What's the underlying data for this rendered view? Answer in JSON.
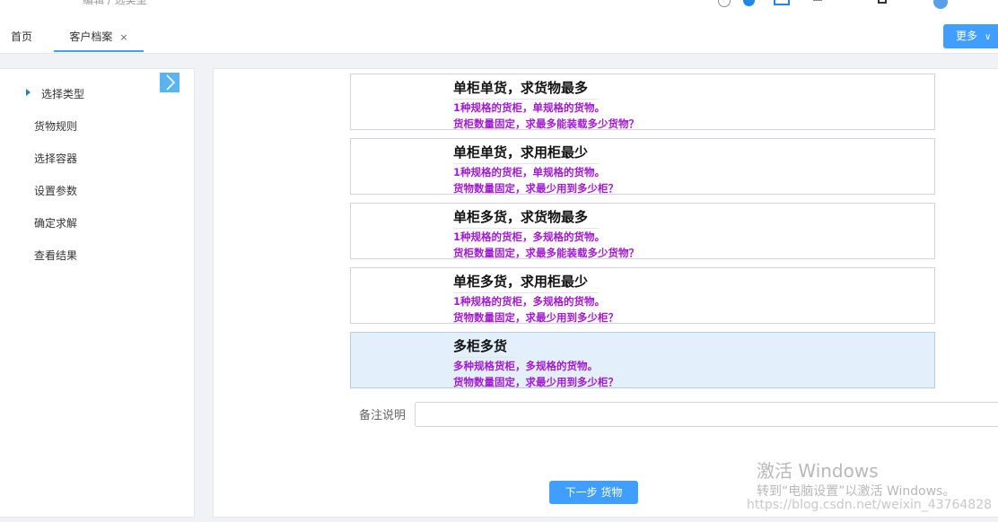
{
  "app": {
    "header_partial_title": "编辑 / 选类型"
  },
  "tabs": [
    {
      "label": "首页"
    },
    {
      "label": "客户档案",
      "close": "×"
    }
  ],
  "more_button": {
    "label": "更多",
    "caret": "∨"
  },
  "sidebar": {
    "collapse_icon": "›",
    "steps": [
      {
        "label": "选择类型",
        "active": true
      },
      {
        "label": "货物规则"
      },
      {
        "label": "选择容器"
      },
      {
        "label": "设置参数"
      },
      {
        "label": "确定求解"
      },
      {
        "label": "查看结果"
      }
    ]
  },
  "options": [
    {
      "title": "单柜单货，求货物最多",
      "line1": "1种规格的货柜，单规格的货物。",
      "line2": "货柜数量固定，求最多能装载多少货物？",
      "selected": false
    },
    {
      "title": "单柜单货，求用柜最少",
      "line1": "1种规格的货柜，单规格的货物。",
      "line2": "货物数量固定，求最少用到多少柜？",
      "selected": false
    },
    {
      "title": "单柜多货，求货物最多",
      "line1": "1种规格的货柜，多规格的货物。",
      "line2": "货柜数量固定，求最多能装载多少货物？",
      "selected": false
    },
    {
      "title": "单柜多货，求用柜最少",
      "line1": "1种规格的货柜，多规格的货物。",
      "line2": "货物数量固定，求最少用到多少柜？",
      "selected": false
    },
    {
      "title": "多柜多货",
      "line1": "多种规格货柜，多规格的货物。",
      "line2": "货物数量固定，求最少用到多少柜？",
      "selected": true
    }
  ],
  "remark": {
    "label": "备注说明",
    "value": ""
  },
  "next_button": {
    "label": "下一步 货物"
  },
  "watermarks": {
    "activate_title": "激活 Windows",
    "activate_sub": "转到“电脑设置”以激活 Windows。",
    "blog": "https://blog.csdn.net/weixin_43764828"
  },
  "colors": {
    "accent": "#409eff",
    "option_text": "#a21ad0",
    "selected_bg": "#e3effb"
  }
}
